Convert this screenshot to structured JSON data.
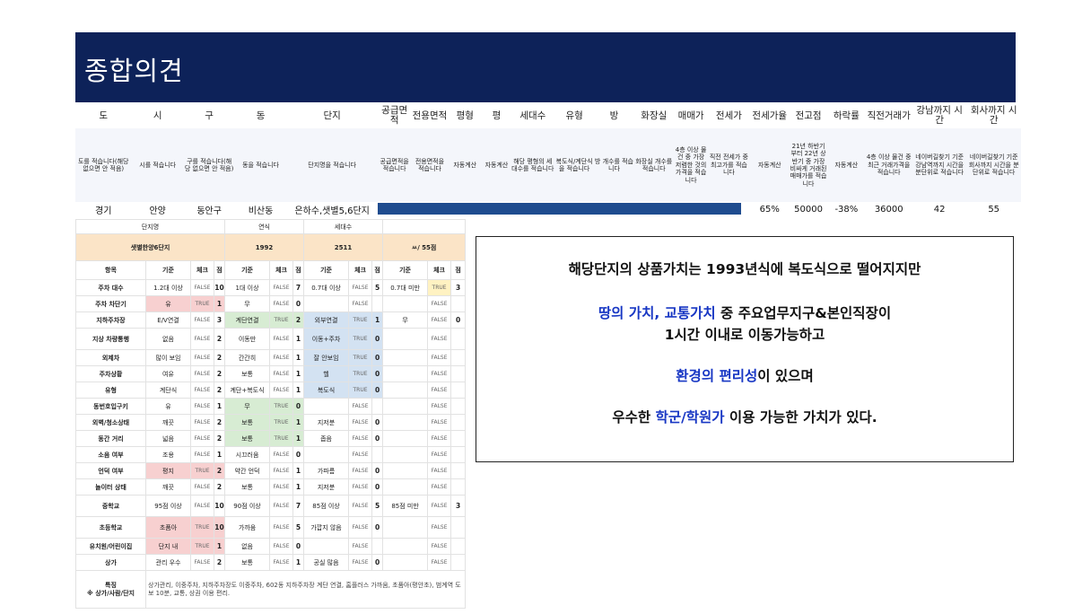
{
  "title": "종합의견",
  "summary": {
    "headers": [
      "도",
      "시",
      "구",
      "동",
      "단지",
      "공급면적",
      "전용면적",
      "평형",
      "평",
      "세대수",
      "유형",
      "방",
      "화장실",
      "매매가",
      "전세가",
      "전세가율",
      "전고점",
      "하락률",
      "직전거래가",
      "강남까지 시간",
      "회사까지 시간"
    ],
    "descriptions": [
      "도를 적습니다(해당 없으면 안 적음)",
      "시를 적습니다",
      "구를 적습니다(해당 없으면 안 적음)",
      "동을 적습니다",
      "단지명을 적습니다",
      "공급면적을 적습니다",
      "전용면적을 적습니다",
      "자동계산",
      "자동계산",
      "해당 평형의 세대수를 적습니다",
      "복도식/계단식을 적습니다",
      "방 개수를 적습니다",
      "화장실 개수를 적습니다",
      "4층 이상 물건 중 가장 저렴한 것의 가격을 적습니다",
      "직전 전세가 중 최고가를 적습니다",
      "자동계산",
      "21년 하반기부터 22년 상반기 중 가장 비싸게 거래된 매매가를 적습니다",
      "자동계산",
      "4층 이상 물건 중 최근 거래가격을 적습니다",
      "네이버길찾기 기준 강남역까지 시간을 분단위로 적습니다",
      "네이버길찾기 기준 회사까지 시간을 분단위로 적습니다"
    ],
    "values": {
      "do": "경기",
      "si": "안양",
      "gu": "동안구",
      "dong": "비산동",
      "complex": "은하수,샛별5,6단지",
      "jeonse_rate": "65%",
      "peak": "50000",
      "drop": "-38%",
      "last_trade": "36000",
      "gangnam": "42",
      "company": "55"
    }
  },
  "checklist": {
    "hdr_complex": "단지명",
    "hdr_year": "연식",
    "hdr_units": "세대수",
    "complex": "샛별한양6단지",
    "year": "1992",
    "units": "2511",
    "score": "ㅆ/ 55점",
    "grid_head": [
      "항목",
      "기준",
      "체크",
      "점",
      "기준",
      "체크",
      "점",
      "기준",
      "체크",
      "점",
      "기준",
      "체크",
      "점"
    ],
    "rows": [
      [
        "주차 대수",
        "1.2대 이상",
        "FALSE",
        "10",
        "1대 이상",
        "FALSE",
        "7",
        "0.7대 이상",
        "FALSE",
        "5",
        "0.7대 미만",
        "TRUE",
        "3"
      ],
      [
        "주차 차단기",
        "유",
        "TRUE",
        "1",
        "무",
        "FALSE",
        "0",
        "",
        "FALSE",
        "",
        "",
        "FALSE",
        ""
      ],
      [
        "지하주차장",
        "E/V연결",
        "FALSE",
        "3",
        "계단연결",
        "TRUE",
        "2",
        "외부연결",
        "TRUE",
        "1",
        "무",
        "FALSE",
        "0"
      ],
      [
        "지상 차량통행",
        "없음",
        "FALSE",
        "2",
        "이동만",
        "FALSE",
        "1",
        "이동+주차",
        "TRUE",
        "0",
        "",
        "FALSE",
        ""
      ],
      [
        "외제차",
        "많이 보임",
        "FALSE",
        "2",
        "간간히",
        "FALSE",
        "1",
        "잘 안보임",
        "TRUE",
        "0",
        "",
        "FALSE",
        ""
      ],
      [
        "주차상황",
        "여유",
        "FALSE",
        "2",
        "보통",
        "FALSE",
        "1",
        "헬",
        "TRUE",
        "0",
        "",
        "FALSE",
        ""
      ],
      [
        "유형",
        "계단식",
        "FALSE",
        "2",
        "계단+복도식",
        "FALSE",
        "1",
        "복도식",
        "TRUE",
        "0",
        "",
        "FALSE",
        ""
      ],
      [
        "동번호입구키",
        "유",
        "FALSE",
        "1",
        "무",
        "TRUE",
        "0",
        "",
        "FALSE",
        "",
        "",
        "FALSE",
        ""
      ],
      [
        "외벽/청소상태",
        "깨끗",
        "FALSE",
        "2",
        "보통",
        "TRUE",
        "1",
        "지저분",
        "FALSE",
        "0",
        "",
        "FALSE",
        ""
      ],
      [
        "동간 거리",
        "넓음",
        "FALSE",
        "2",
        "보통",
        "TRUE",
        "1",
        "좁음",
        "FALSE",
        "0",
        "",
        "FALSE",
        ""
      ],
      [
        "소음 여부",
        "조용",
        "FALSE",
        "1",
        "시끄러움",
        "FALSE",
        "0",
        "",
        "FALSE",
        "",
        "",
        "FALSE",
        ""
      ],
      [
        "언덕 여부",
        "평지",
        "TRUE",
        "2",
        "약간 언덕",
        "FALSE",
        "1",
        "가파름",
        "FALSE",
        "0",
        "",
        "FALSE",
        ""
      ],
      [
        "놀이터 상태",
        "깨끗",
        "FALSE",
        "2",
        "보통",
        "FALSE",
        "1",
        "지저분",
        "FALSE",
        "0",
        "",
        "FALSE",
        ""
      ],
      [
        "중학교",
        "95점 이상",
        "FALSE",
        "10",
        "90점 이상",
        "FALSE",
        "7",
        "85점 이상",
        "FALSE",
        "5",
        "85점 미만",
        "FALSE",
        "3"
      ],
      [
        "초등학교",
        "초품아",
        "TRUE",
        "10",
        "가까움",
        "FALSE",
        "5",
        "가깝지 않음",
        "FALSE",
        "0",
        "",
        "FALSE",
        ""
      ],
      [
        "유치원/어린이집",
        "단지 내",
        "TRUE",
        "1",
        "없음",
        "FALSE",
        "0",
        "",
        "FALSE",
        "",
        "",
        "FALSE",
        ""
      ],
      [
        "상가",
        "관리 우수",
        "FALSE",
        "2",
        "보통",
        "FALSE",
        "1",
        "공실 많음",
        "FALSE",
        "0",
        "",
        "FALSE",
        ""
      ]
    ],
    "note_label": "특징\n※ 상가/사람/단지",
    "note": "상가관리, 이중주차, 지하주차장도 이중주차, 602동 지하주차장 계단 연결, 홈플러스 가까움, 초품아(평안초), 범계역 도보 10분, 교통, 상권 이용 편리."
  },
  "opinion": {
    "line1": "해당단지의 상품가치는 1993년식에 복도식으로 떨어지지만",
    "line2_hl": "땅의 가치, 교통가치",
    "line2_rest": " 중 주요업무지구&본인직장이",
    "line3": "1시간 이내로 이동가능하고",
    "line4_hl": "환경의 편리성",
    "line4_rest": "이 있으며",
    "line5_pre": "우수한 ",
    "line5_hl": "학군/학원가",
    "line5_rest": " 이용 가능한 가치가 있다."
  },
  "colors": {
    "header_bg": "#0d2259",
    "highlight": "#1837c4",
    "bar": "#1f4c8f"
  }
}
